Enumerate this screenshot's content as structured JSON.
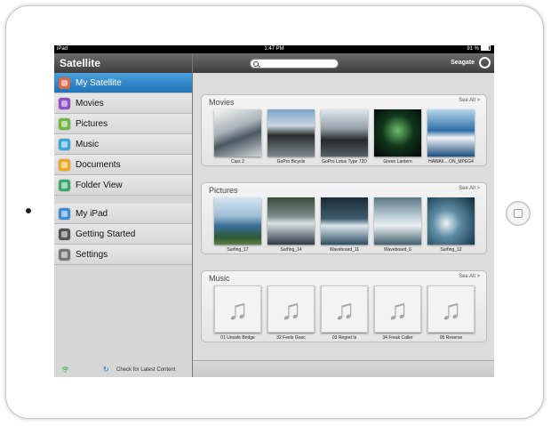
{
  "status_bar": {
    "carrier": "iPad",
    "time": "1:47 PM",
    "battery": "91 %"
  },
  "sidebar": {
    "title": "Satellite",
    "items": [
      {
        "label": "My Satellite",
        "icon": "satellite-icon",
        "color": "#d96a4a",
        "active": true
      },
      {
        "label": "Movies",
        "icon": "movies-icon",
        "color": "#8e4fc9",
        "active": false
      },
      {
        "label": "Pictures",
        "icon": "pictures-icon",
        "color": "#71b640",
        "active": false
      },
      {
        "label": "Music",
        "icon": "music-icon",
        "color": "#3aa6d9",
        "active": false
      },
      {
        "label": "Documents",
        "icon": "documents-icon",
        "color": "#f2a81d",
        "active": false
      },
      {
        "label": "Folder View",
        "icon": "folder-icon",
        "color": "#3aa86a",
        "active": false
      }
    ],
    "items2": [
      {
        "label": "My iPad",
        "icon": "ipad-icon",
        "color": "#3b8fd6"
      },
      {
        "label": "Getting Started",
        "icon": "help-icon",
        "color": "#555555"
      },
      {
        "label": "Settings",
        "icon": "settings-icon",
        "color": "#777777"
      }
    ],
    "footer": {
      "check_label": "Check for Latest Content"
    }
  },
  "topbar": {
    "search_placeholder": "",
    "brand": "Seagate"
  },
  "sections": {
    "movies": {
      "title": "Movies",
      "see_all": "See All >",
      "items": [
        {
          "caption": "Cars 2"
        },
        {
          "caption": "GoPro Bicycle"
        },
        {
          "caption": "GoPro Lotus Type 72D"
        },
        {
          "caption": "Green Lantern"
        },
        {
          "caption": "HAWAII....ON_MPEG4"
        }
      ]
    },
    "pictures": {
      "title": "Pictures",
      "see_all": "See All >",
      "items": [
        {
          "caption": "Surfing_17"
        },
        {
          "caption": "Surfing_14"
        },
        {
          "caption": "Waveboard_11"
        },
        {
          "caption": "Waveboard_6"
        },
        {
          "caption": "Surfing_12"
        }
      ]
    },
    "music": {
      "title": "Music",
      "see_all": "See All >",
      "items": [
        {
          "caption": "01 Unsafe Bridge"
        },
        {
          "caption": "32 Feels Gooc"
        },
        {
          "caption": "03 Regret Is"
        },
        {
          "caption": "34 Freak Caller"
        },
        {
          "caption": "05 Reverse"
        }
      ]
    }
  }
}
